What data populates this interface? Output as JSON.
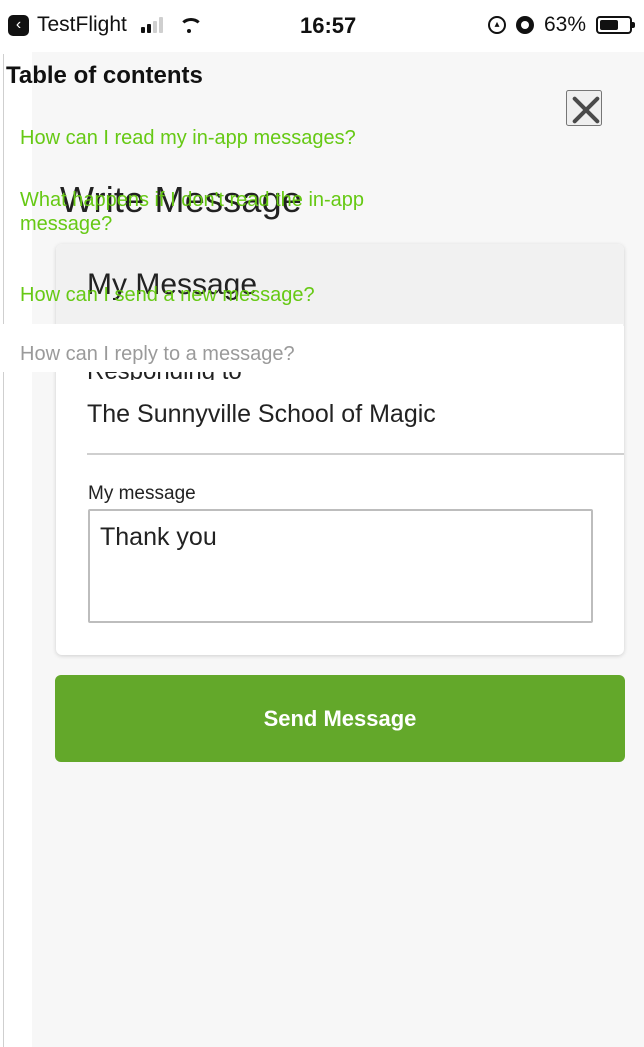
{
  "status_bar": {
    "app": "TestFlight",
    "time": "16:57",
    "battery_percent_text": "63%",
    "battery_level": 0.63,
    "icons": [
      "back-icon",
      "signal-icon",
      "wifi-icon",
      "rotation-lock-icon",
      "alarm-icon",
      "battery-icon"
    ]
  },
  "write_message": {
    "page_title": "Write Message",
    "card_title": "My Message",
    "responding_label": "Responding to",
    "recipient": "The Sunnyville School of Magic",
    "message_label": "My message",
    "message_value": "Thank you",
    "send_label": "Send Message"
  },
  "toc": {
    "title": "Table of contents",
    "items": [
      {
        "label": "How can I read my in-app messages?"
      },
      {
        "label": "What happens if I don't read the in-app message?"
      },
      {
        "label": "How can I send a new message?"
      },
      {
        "label": "How can I reply to a message?"
      }
    ]
  },
  "colors": {
    "accent": "#63a82a",
    "toc_link": "#66c914",
    "toc_link_muted": "#9a9a9a"
  }
}
